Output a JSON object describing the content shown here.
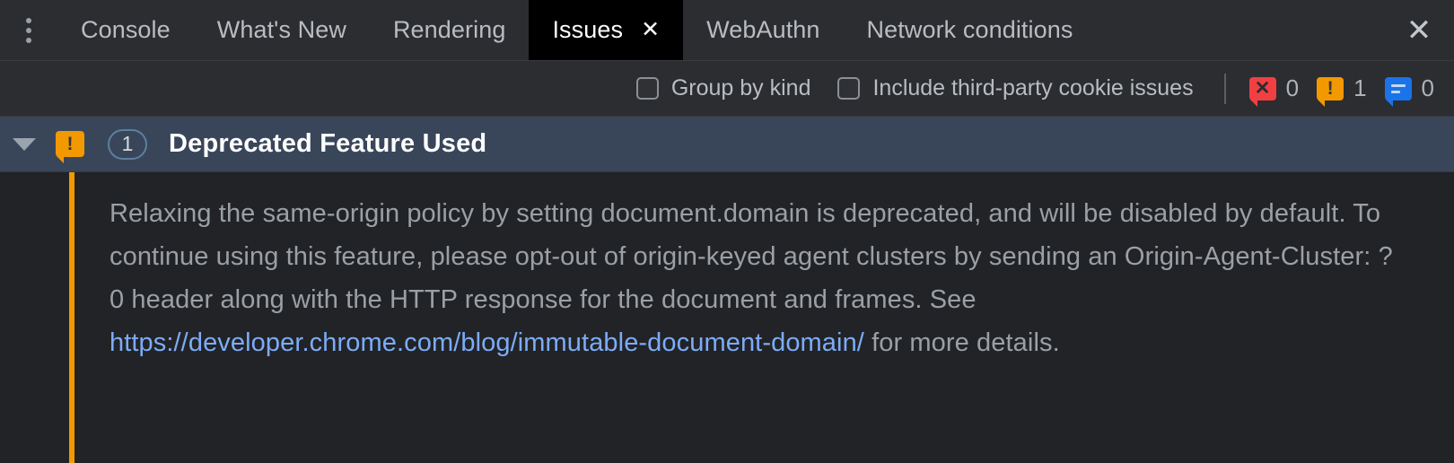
{
  "tabs": [
    {
      "label": "Console",
      "selected": false,
      "closable": false
    },
    {
      "label": "What's New",
      "selected": false,
      "closable": false
    },
    {
      "label": "Rendering",
      "selected": false,
      "closable": false
    },
    {
      "label": "Issues",
      "selected": true,
      "closable": true,
      "close_glyph": "✕"
    },
    {
      "label": "WebAuthn",
      "selected": false,
      "closable": false
    },
    {
      "label": "Network conditions",
      "selected": false,
      "closable": false
    }
  ],
  "tabbar": {
    "menu_icon": "more-vertical-icon",
    "close_panel_glyph": "✕"
  },
  "toolbar": {
    "group_by_kind_label": "Group by kind",
    "group_by_kind_checked": false,
    "include_third_party_label": "Include third-party cookie issues",
    "include_third_party_checked": false,
    "counters": [
      {
        "kind": "error",
        "icon": "error-bubble-icon",
        "glyph": "✕",
        "count": "0",
        "color": "#f23f42"
      },
      {
        "kind": "warning",
        "icon": "warning-bubble-icon",
        "glyph": "!",
        "count": "1",
        "color": "#f29900"
      },
      {
        "kind": "info",
        "icon": "info-bubble-icon",
        "glyph": "",
        "count": "0",
        "color": "#1a73e8"
      }
    ]
  },
  "issue": {
    "expanded": true,
    "caret_icon": "chevron-down-icon",
    "severity_icon": "warning-bubble-icon",
    "severity_color": "#f29900",
    "count": "1",
    "title": "Deprecated Feature Used",
    "body_before_link": "Relaxing the same-origin policy by setting document.domain is deprecated, and will be disabled by default. To continue using this feature, please opt-out of origin-keyed agent clusters by sending an Origin-Agent-Cluster: ?0 header along with the HTTP response for the document and frames. See ",
    "link_text": "https://developer.chrome.com/blog/immutable-document-domain/",
    "body_after_link": " for more details.",
    "rail_color": "#f29900"
  }
}
